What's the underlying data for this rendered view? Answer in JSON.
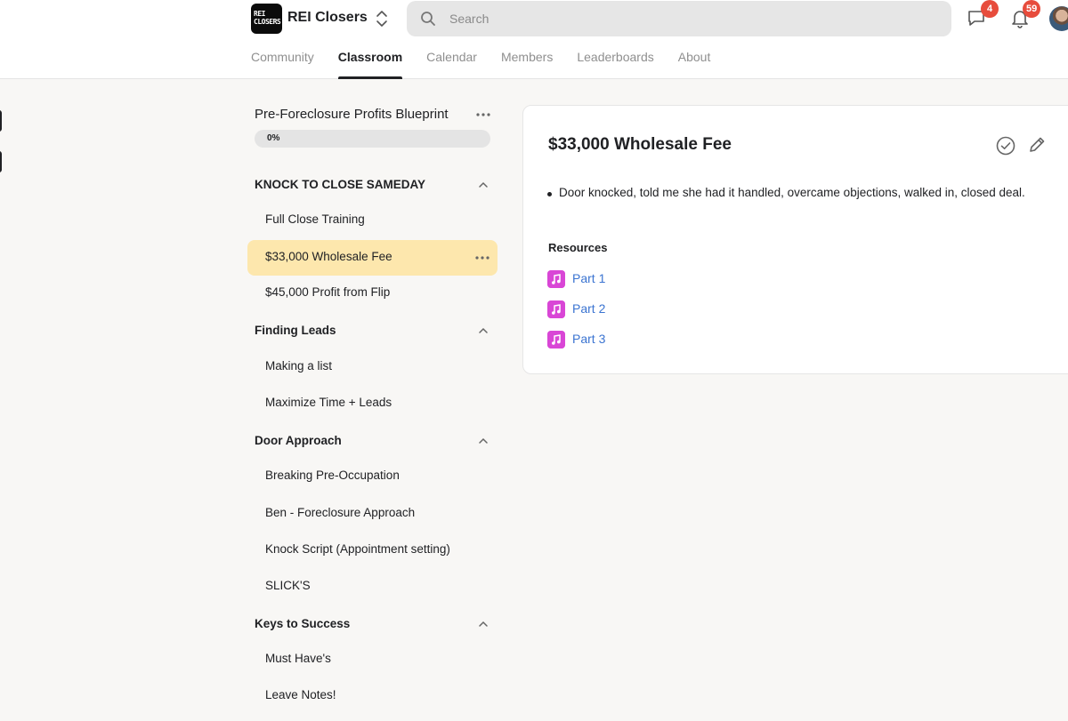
{
  "header": {
    "logo_text": "REI CLOSERS",
    "brand_name": "REI Closers",
    "search_placeholder": "Search",
    "chat_badge": "4",
    "notifications_badge": "59",
    "tabs": [
      "Community",
      "Classroom",
      "Calendar",
      "Members",
      "Leaderboards",
      "About"
    ],
    "active_tab": "Classroom"
  },
  "course": {
    "title": "Pre-Foreclosure Profits Blueprint",
    "progress_label": "0%",
    "progress_value": 0,
    "sections": [
      {
        "title": "KNOCK TO CLOSE SAMEDAY",
        "lessons": [
          "Full Close Training",
          "$33,000 Wholesale Fee",
          "$45,000 Profit from Flip"
        ]
      },
      {
        "title": "Finding Leads",
        "lessons": [
          "Making a list",
          "Maximize Time + Leads"
        ]
      },
      {
        "title": "Door Approach",
        "lessons": [
          "Breaking Pre-Occupation",
          "Ben - Foreclosure Approach",
          "Knock Script (Appointment setting)",
          "SLICK'S"
        ]
      },
      {
        "title": "Keys to Success",
        "lessons": [
          "Must Have's",
          "Leave Notes!"
        ]
      }
    ],
    "active_lesson": "$33,000 Wholesale Fee"
  },
  "lesson": {
    "title": "$33,000 Wholesale Fee",
    "bullets": [
      "Door knocked, told me she had it handled, overcame objections, walked in, closed deal."
    ],
    "resources_heading": "Resources",
    "resources": [
      "Part 1",
      "Part 2",
      "Part 3"
    ]
  },
  "colors": {
    "accent_active": "#fde7ad",
    "link": "#3b74d1",
    "resource_icon": "#d946d6",
    "badge": "#e74c3c"
  }
}
